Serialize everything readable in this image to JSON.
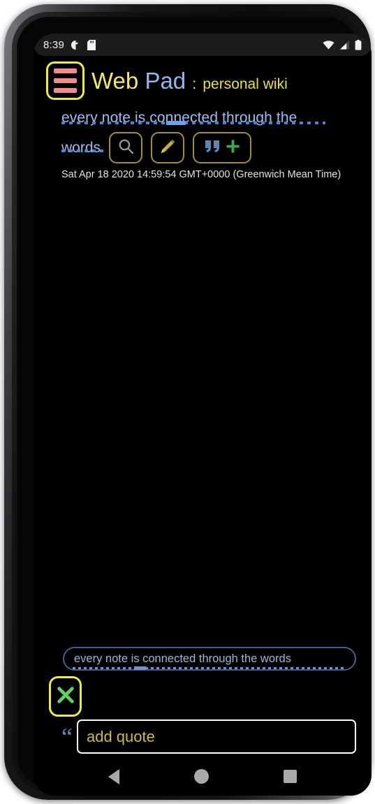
{
  "status_bar": {
    "time": "8:39",
    "left_icons": [
      "brightness-contrast-icon",
      "sd-card-icon"
    ],
    "right_icons": [
      "wifi-icon",
      "cellular-signal-icon",
      "battery-icon"
    ]
  },
  "header": {
    "menu_icon": "hamburger-menu-icon",
    "title_primary": "Web",
    "title_secondary": "Pad",
    "title_separator": ":",
    "title_subtitle": "personal wiki"
  },
  "note": {
    "heading": "every note is connected through the",
    "heading_second_line": "words",
    "timestamp": "Sat Apr 18 2020 14:59:54 GMT+0000 (Greenwich Mean Time)"
  },
  "toolbar": {
    "search_icon": "search-icon",
    "edit_icon": "pencil-edit-icon",
    "add_quote_icon": "quote-plus-icon"
  },
  "footer": {
    "note_pill_label": "every note is connected through the words",
    "close_icon": "green-x-close-icon",
    "quote_glyph": "“",
    "quote_input_value": "",
    "quote_input_placeholder": "add quote"
  },
  "nav_bar": {
    "back": "back-triangle-icon",
    "home": "home-circle-icon",
    "recents": "recents-square-icon"
  },
  "colors": {
    "accent_yellow": "#ece94a",
    "menu_bar_pink": "#f08b8f",
    "title_blue": "#93b7f0",
    "heading_blue": "#9ebef2",
    "button_border_olive": "#9c9135",
    "placeholder_olive": "#c8bd4a",
    "close_green": "#62d162",
    "quote_blue": "#5d84b8",
    "background": "#000000",
    "status_bar_bg": "#1c1c1c"
  }
}
